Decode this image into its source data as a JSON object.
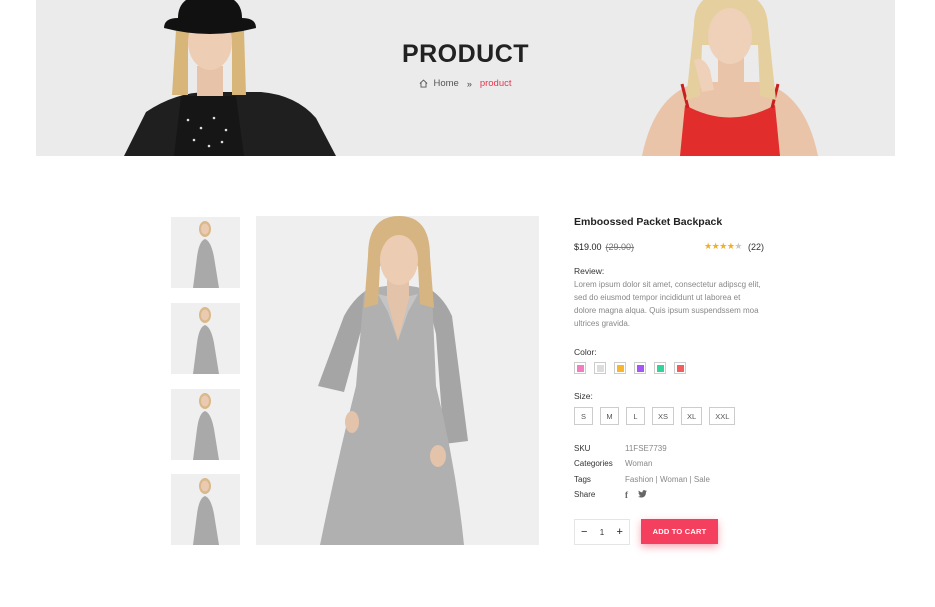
{
  "banner": {
    "title": "PRODUCT",
    "breadcrumb": {
      "home": "Home",
      "current": "product"
    }
  },
  "gallery": {
    "thumbnails": [
      "thumbnail-1",
      "thumbnail-2",
      "thumbnail-3",
      "thumbnail-4"
    ]
  },
  "product": {
    "title": "Emboossed Packet Backpack",
    "price": "$19.00",
    "old_price": "(29.00)",
    "rating": 4,
    "rating_max": 5,
    "review_count": "(22)",
    "review_label": "Review:",
    "description": "Lorem ipsum dolor sit amet, consectetur adipscg elit, sed do eiusmod tempor incididunt ut laborea et dolore magna alqua. Quis ipsum suspendssem moa ultrices gravida.",
    "color_label": "Color:",
    "colors": [
      "#f27ec1",
      "#dcdcdc",
      "#f9b52c",
      "#a855f7",
      "#34d399",
      "#f25e5e"
    ],
    "size_label": "Size:",
    "sizes": [
      "S",
      "M",
      "L",
      "XS",
      "XL",
      "XXL"
    ],
    "meta": {
      "sku_label": "SKU",
      "sku": "11FSE7739",
      "categories_label": "Categories",
      "categories": "Woman",
      "tags_label": "Tags",
      "tags": "Fashion | Woman | Sale",
      "share_label": "Share"
    },
    "share_icons": [
      "facebook-icon",
      "twitter-icon"
    ],
    "quantity": "1",
    "add_to_cart": "ADD TO CART"
  },
  "colors": {
    "accent": "#f43f5e",
    "star": "#f2b01e",
    "banner_bg": "#ebebeb"
  }
}
